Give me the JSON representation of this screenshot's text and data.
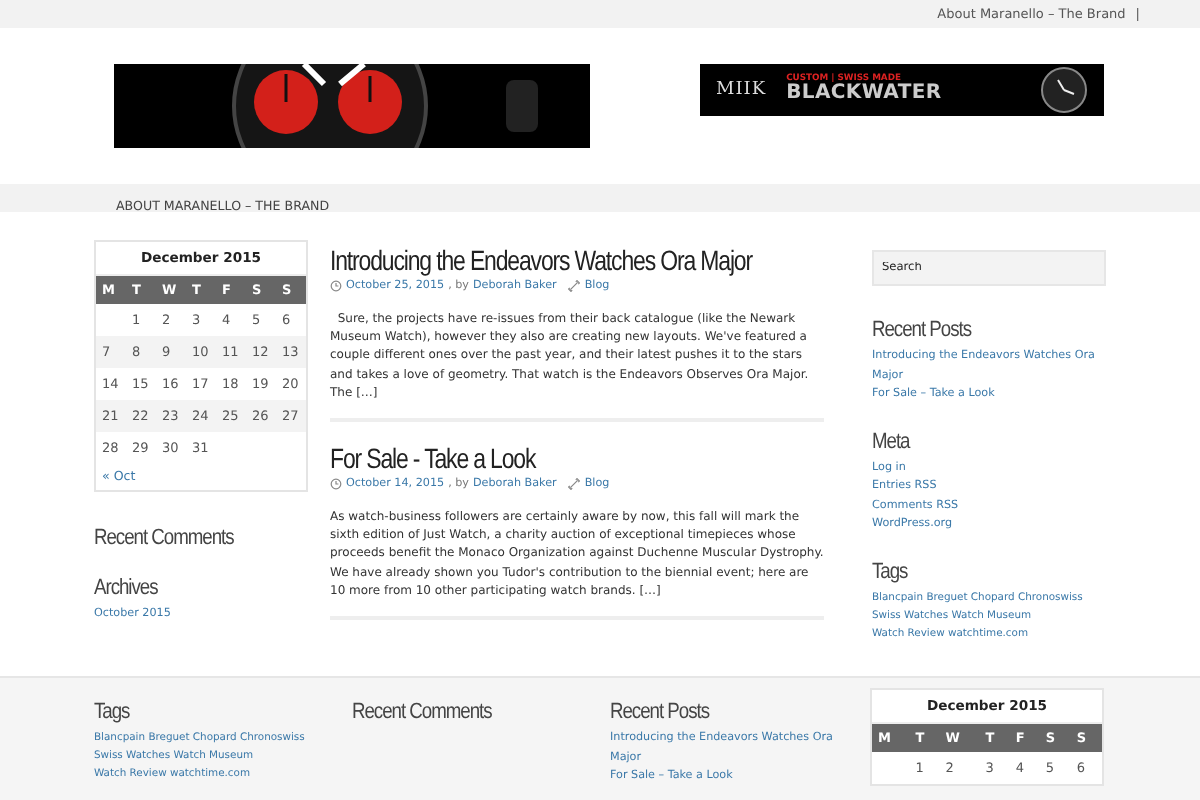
{
  "top_bar": {
    "links": [
      "About Maranello – The Brand"
    ],
    "separator": "|"
  },
  "header": {
    "banner_right": {
      "brand": "MIIK",
      "tagline": "CUSTOM | SWISS MADE",
      "name": "BLACKWATER"
    }
  },
  "nav": {
    "items": [
      {
        "label": "ABOUT MARANELLO – THE BRAND",
        "selected": false
      }
    ]
  },
  "left_sidebar": {
    "calendar": {
      "title": "December 2015",
      "weekdays": [
        "M",
        "T",
        "W",
        "T",
        "F",
        "S",
        "S"
      ],
      "weeks": [
        [
          "1",
          "2",
          "3",
          "4",
          "5",
          "6"
        ],
        [
          "7",
          "8",
          "9",
          "10",
          "11",
          "12",
          "13"
        ],
        [
          "14",
          "15",
          "16",
          "17",
          "18",
          "19",
          "20"
        ],
        [
          "21",
          "22",
          "23",
          "24",
          "25",
          "26",
          "27"
        ],
        [
          "28",
          "29",
          "30",
          "31"
        ]
      ],
      "prev_link": "« Oct"
    },
    "widgets": [
      {
        "title": "Recent Comments"
      },
      {
        "title": "Archives",
        "links": [
          "October 2015"
        ]
      }
    ]
  },
  "posts": [
    {
      "title": "Introducing the Endeavors Watches Ora Major",
      "date": "October 25, 2015",
      "by": ", by",
      "author": "Deborah Baker",
      "category": "Blog",
      "excerpt": "  Sure, the projects have re-issues from their back catalogue (like the Newark Museum Watch), however they also are creating new layouts. We've featured a couple different ones over the past year, and their latest pushes it to the stars and takes a love of geometry. That watch is the Endeavors Observes Ora Major. The […]"
    },
    {
      "title": "For Sale - Take a Look",
      "date": "October 14, 2015",
      "by": ", by",
      "author": "Deborah Baker",
      "category": "Blog",
      "excerpt": "As watch-business followers are certainly aware by now, this fall will mark the sixth edition of Just Watch, a charity auction of exceptional timepieces whose proceeds benefit the Monaco Organization against Duchenne Muscular Dystrophy. We have already shown you Tudor's contribution to the biennial event; here are 10 more from 10 other participating watch brands. […]"
    }
  ],
  "right_sidebar": {
    "search": {
      "placeholder": "Search"
    },
    "widgets": [
      {
        "title": "Recent Posts",
        "links": [
          "Introducing the Endeavors Watches Ora Major",
          "For Sale – Take a Look"
        ]
      },
      {
        "title": "Meta",
        "links": [
          "Log in",
          "Entries RSS",
          "Comments RSS",
          "WordPress.org"
        ]
      },
      {
        "title": "Tags",
        "tags": [
          "Blancpain",
          "Breguet",
          "Chopard",
          "Chronoswiss",
          "Swiss Watches",
          "Watch Museum",
          "Watch Review",
          "watchtime.com"
        ]
      }
    ]
  },
  "footer": {
    "widgets": [
      {
        "title": "Tags",
        "tags": [
          "Blancpain",
          "Breguet",
          "Chopard",
          "Chronoswiss",
          "Swiss Watches",
          "Watch Museum",
          "Watch Review",
          "watchtime.com"
        ]
      },
      {
        "title": "Recent Comments"
      },
      {
        "title": "Recent Posts",
        "links": [
          "Introducing the Endeavors Watches Ora Major",
          "For Sale – Take a Look"
        ]
      }
    ],
    "calendar": {
      "title": "December 2015",
      "weekdays": [
        "M",
        "T",
        "W",
        "T",
        "F",
        "S",
        "S"
      ],
      "weeks": [
        [
          "1",
          "2",
          "3",
          "4",
          "5",
          "6"
        ]
      ]
    }
  }
}
